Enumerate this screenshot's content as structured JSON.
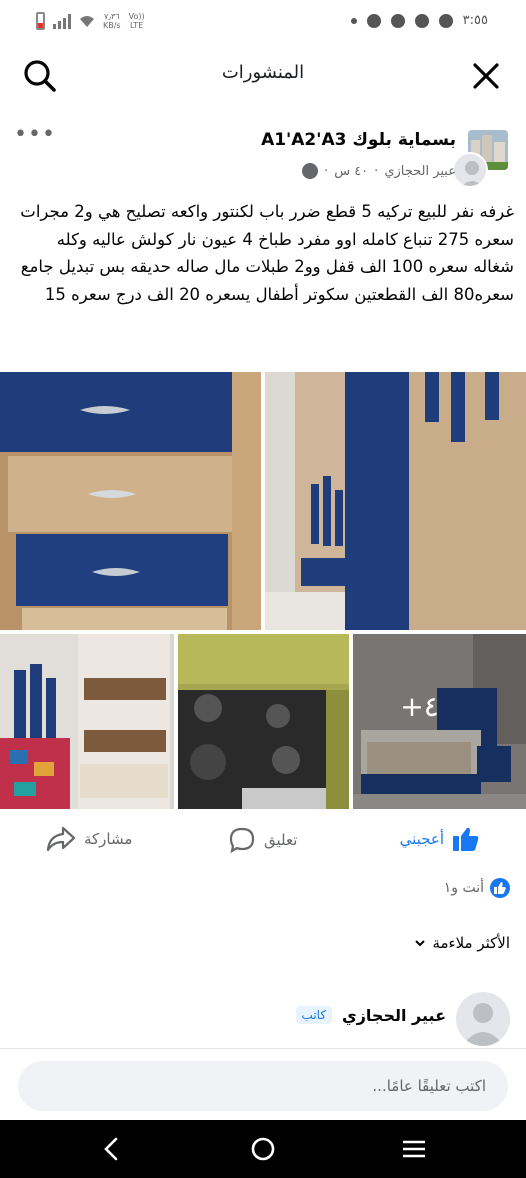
{
  "status_bar": {
    "time": "٣:٥٥",
    "speed_value": "٧٫٣٦",
    "speed_unit": "KB/s",
    "network_1": "Vo))",
    "network_2": "LTE"
  },
  "header": {
    "title": "المنشورات",
    "search_icon": "search-icon",
    "close_icon": "close-icon"
  },
  "post": {
    "group_name": "بسماية بلوك A1'A2'A3",
    "author": "عبير الحجازي",
    "time_ago": "٤٠ س",
    "separator": "·",
    "text": "غرفه نفر للبيع  تركيه 5 قطع  ضرر باب لكنتور واكعه تصليح هي و2 مجرات سعره 275 تنباع كامله اوو مفرد طباخ 4 عيون نار كولش عاليه وكله شغاله سعره 100 الف قفل وو2 طبلات مال صاله حديقه بس تبديل جامع  سعره80 الف القطعتين  سكوتر أطفال يسعره 20 الف درج سعره 15",
    "more_photos": "+٤"
  },
  "actions": {
    "like": "أعجبني",
    "comment": "تعليق",
    "share": "مشاركة"
  },
  "reactions": {
    "summary": "أنت و١"
  },
  "sort": {
    "label": "الأكثر ملاءمة"
  },
  "comment": {
    "author": "عبير الحجازي",
    "badge": "كاتب"
  },
  "composer": {
    "placeholder": "اكتب تعليقًا عامًا..."
  },
  "colors": {
    "accent": "#1877f2",
    "muted": "#65676b"
  }
}
